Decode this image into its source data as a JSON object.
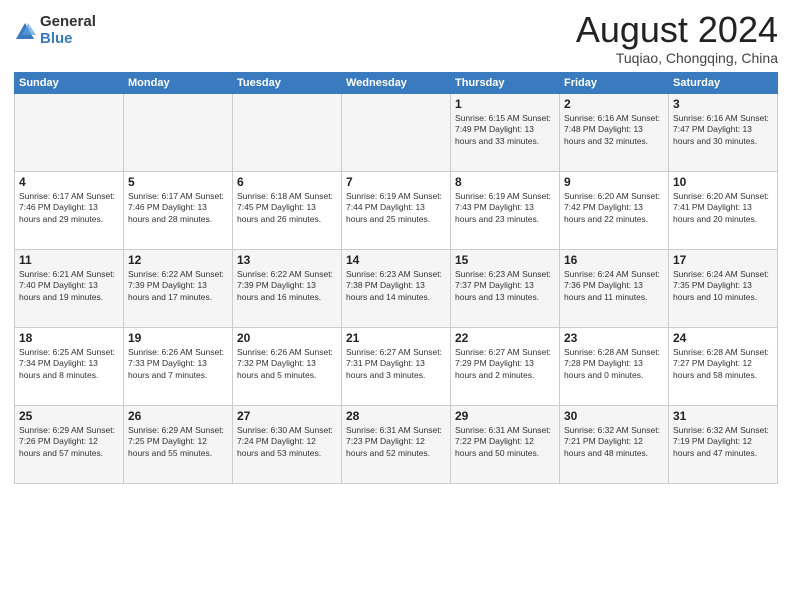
{
  "logo": {
    "general": "General",
    "blue": "Blue"
  },
  "header": {
    "month": "August 2024",
    "location": "Tuqiao, Chongqing, China"
  },
  "days_of_week": [
    "Sunday",
    "Monday",
    "Tuesday",
    "Wednesday",
    "Thursday",
    "Friday",
    "Saturday"
  ],
  "weeks": [
    [
      {
        "day": "",
        "info": ""
      },
      {
        "day": "",
        "info": ""
      },
      {
        "day": "",
        "info": ""
      },
      {
        "day": "",
        "info": ""
      },
      {
        "day": "1",
        "info": "Sunrise: 6:15 AM\nSunset: 7:49 PM\nDaylight: 13 hours\nand 33 minutes."
      },
      {
        "day": "2",
        "info": "Sunrise: 6:16 AM\nSunset: 7:48 PM\nDaylight: 13 hours\nand 32 minutes."
      },
      {
        "day": "3",
        "info": "Sunrise: 6:16 AM\nSunset: 7:47 PM\nDaylight: 13 hours\nand 30 minutes."
      }
    ],
    [
      {
        "day": "4",
        "info": "Sunrise: 6:17 AM\nSunset: 7:46 PM\nDaylight: 13 hours\nand 29 minutes."
      },
      {
        "day": "5",
        "info": "Sunrise: 6:17 AM\nSunset: 7:46 PM\nDaylight: 13 hours\nand 28 minutes."
      },
      {
        "day": "6",
        "info": "Sunrise: 6:18 AM\nSunset: 7:45 PM\nDaylight: 13 hours\nand 26 minutes."
      },
      {
        "day": "7",
        "info": "Sunrise: 6:19 AM\nSunset: 7:44 PM\nDaylight: 13 hours\nand 25 minutes."
      },
      {
        "day": "8",
        "info": "Sunrise: 6:19 AM\nSunset: 7:43 PM\nDaylight: 13 hours\nand 23 minutes."
      },
      {
        "day": "9",
        "info": "Sunrise: 6:20 AM\nSunset: 7:42 PM\nDaylight: 13 hours\nand 22 minutes."
      },
      {
        "day": "10",
        "info": "Sunrise: 6:20 AM\nSunset: 7:41 PM\nDaylight: 13 hours\nand 20 minutes."
      }
    ],
    [
      {
        "day": "11",
        "info": "Sunrise: 6:21 AM\nSunset: 7:40 PM\nDaylight: 13 hours\nand 19 minutes."
      },
      {
        "day": "12",
        "info": "Sunrise: 6:22 AM\nSunset: 7:39 PM\nDaylight: 13 hours\nand 17 minutes."
      },
      {
        "day": "13",
        "info": "Sunrise: 6:22 AM\nSunset: 7:39 PM\nDaylight: 13 hours\nand 16 minutes."
      },
      {
        "day": "14",
        "info": "Sunrise: 6:23 AM\nSunset: 7:38 PM\nDaylight: 13 hours\nand 14 minutes."
      },
      {
        "day": "15",
        "info": "Sunrise: 6:23 AM\nSunset: 7:37 PM\nDaylight: 13 hours\nand 13 minutes."
      },
      {
        "day": "16",
        "info": "Sunrise: 6:24 AM\nSunset: 7:36 PM\nDaylight: 13 hours\nand 11 minutes."
      },
      {
        "day": "17",
        "info": "Sunrise: 6:24 AM\nSunset: 7:35 PM\nDaylight: 13 hours\nand 10 minutes."
      }
    ],
    [
      {
        "day": "18",
        "info": "Sunrise: 6:25 AM\nSunset: 7:34 PM\nDaylight: 13 hours\nand 8 minutes."
      },
      {
        "day": "19",
        "info": "Sunrise: 6:26 AM\nSunset: 7:33 PM\nDaylight: 13 hours\nand 7 minutes."
      },
      {
        "day": "20",
        "info": "Sunrise: 6:26 AM\nSunset: 7:32 PM\nDaylight: 13 hours\nand 5 minutes."
      },
      {
        "day": "21",
        "info": "Sunrise: 6:27 AM\nSunset: 7:31 PM\nDaylight: 13 hours\nand 3 minutes."
      },
      {
        "day": "22",
        "info": "Sunrise: 6:27 AM\nSunset: 7:29 PM\nDaylight: 13 hours\nand 2 minutes."
      },
      {
        "day": "23",
        "info": "Sunrise: 6:28 AM\nSunset: 7:28 PM\nDaylight: 13 hours\nand 0 minutes."
      },
      {
        "day": "24",
        "info": "Sunrise: 6:28 AM\nSunset: 7:27 PM\nDaylight: 12 hours\nand 58 minutes."
      }
    ],
    [
      {
        "day": "25",
        "info": "Sunrise: 6:29 AM\nSunset: 7:26 PM\nDaylight: 12 hours\nand 57 minutes."
      },
      {
        "day": "26",
        "info": "Sunrise: 6:29 AM\nSunset: 7:25 PM\nDaylight: 12 hours\nand 55 minutes."
      },
      {
        "day": "27",
        "info": "Sunrise: 6:30 AM\nSunset: 7:24 PM\nDaylight: 12 hours\nand 53 minutes."
      },
      {
        "day": "28",
        "info": "Sunrise: 6:31 AM\nSunset: 7:23 PM\nDaylight: 12 hours\nand 52 minutes."
      },
      {
        "day": "29",
        "info": "Sunrise: 6:31 AM\nSunset: 7:22 PM\nDaylight: 12 hours\nand 50 minutes."
      },
      {
        "day": "30",
        "info": "Sunrise: 6:32 AM\nSunset: 7:21 PM\nDaylight: 12 hours\nand 48 minutes."
      },
      {
        "day": "31",
        "info": "Sunrise: 6:32 AM\nSunset: 7:19 PM\nDaylight: 12 hours\nand 47 minutes."
      }
    ]
  ]
}
